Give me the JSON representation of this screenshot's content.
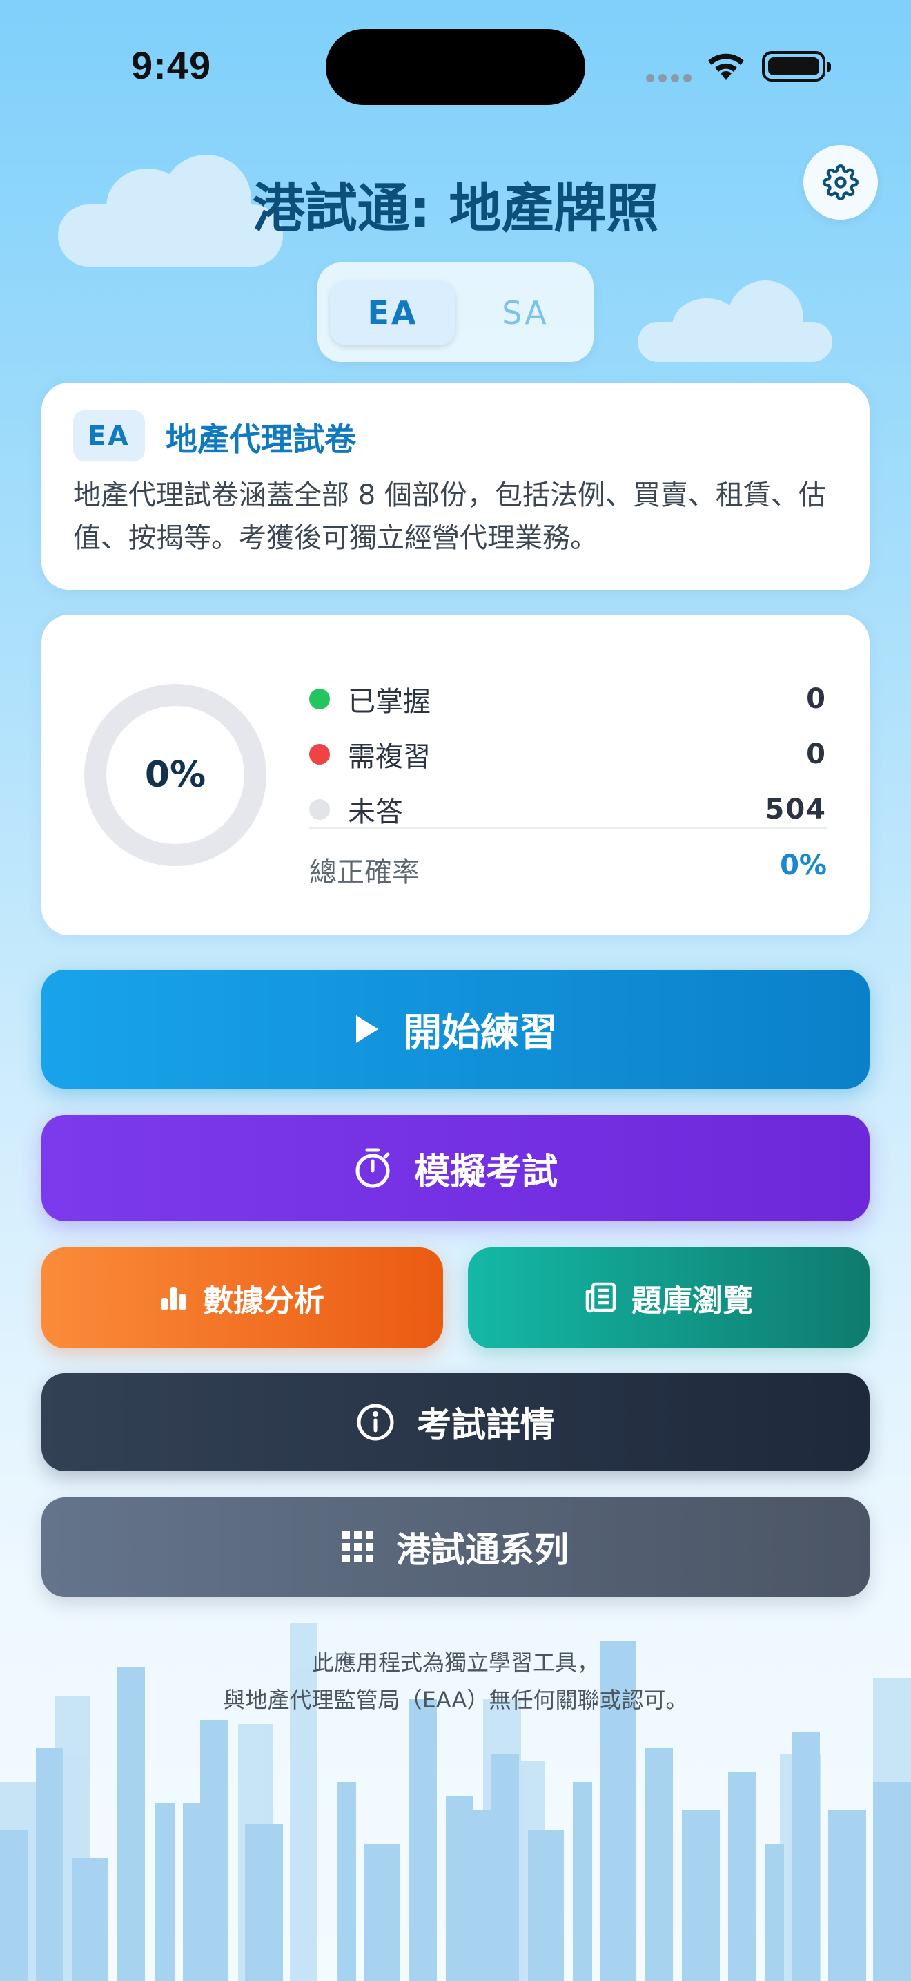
{
  "status_bar": {
    "time": "9:49"
  },
  "header": {
    "title": "港試通: 地產牌照"
  },
  "segment": {
    "options": [
      "EA",
      "SA"
    ],
    "selected": "EA"
  },
  "info_card": {
    "badge": "EA",
    "title": "地產代理試卷",
    "description": "地產代理試卷涵蓋全部 8 個部份，包括法例、買賣、租賃、估值、按揭等。考獲後可獨立經營代理業務。"
  },
  "stats": {
    "progress_percent_label": "0%",
    "progress_fraction": 0,
    "rows": [
      {
        "label": "已掌握",
        "value": "0",
        "color": "#22c55e"
      },
      {
        "label": "需複習",
        "value": "0",
        "color": "#ef4444"
      },
      {
        "label": "未答",
        "value": "504",
        "color": "#e2e4ea"
      }
    ],
    "accuracy_label": "總正確率",
    "accuracy_value": "0%"
  },
  "buttons": {
    "start": "開始練習",
    "exam": "模擬考試",
    "analysis": "數據分析",
    "bank": "題庫瀏覽",
    "detail": "考試詳情",
    "series": "港試通系列"
  },
  "footer": {
    "line1": "此應用程式為獨立學習工具，",
    "line2": "與地產代理監管局（EAA）無任何關聯或認可。"
  },
  "icons": {
    "settings": "gear-icon",
    "start": "play-icon",
    "exam": "stopwatch-icon",
    "analysis": "bar-chart-icon",
    "bank": "newspaper-icon",
    "detail": "info-icon",
    "series": "grid-icon"
  }
}
